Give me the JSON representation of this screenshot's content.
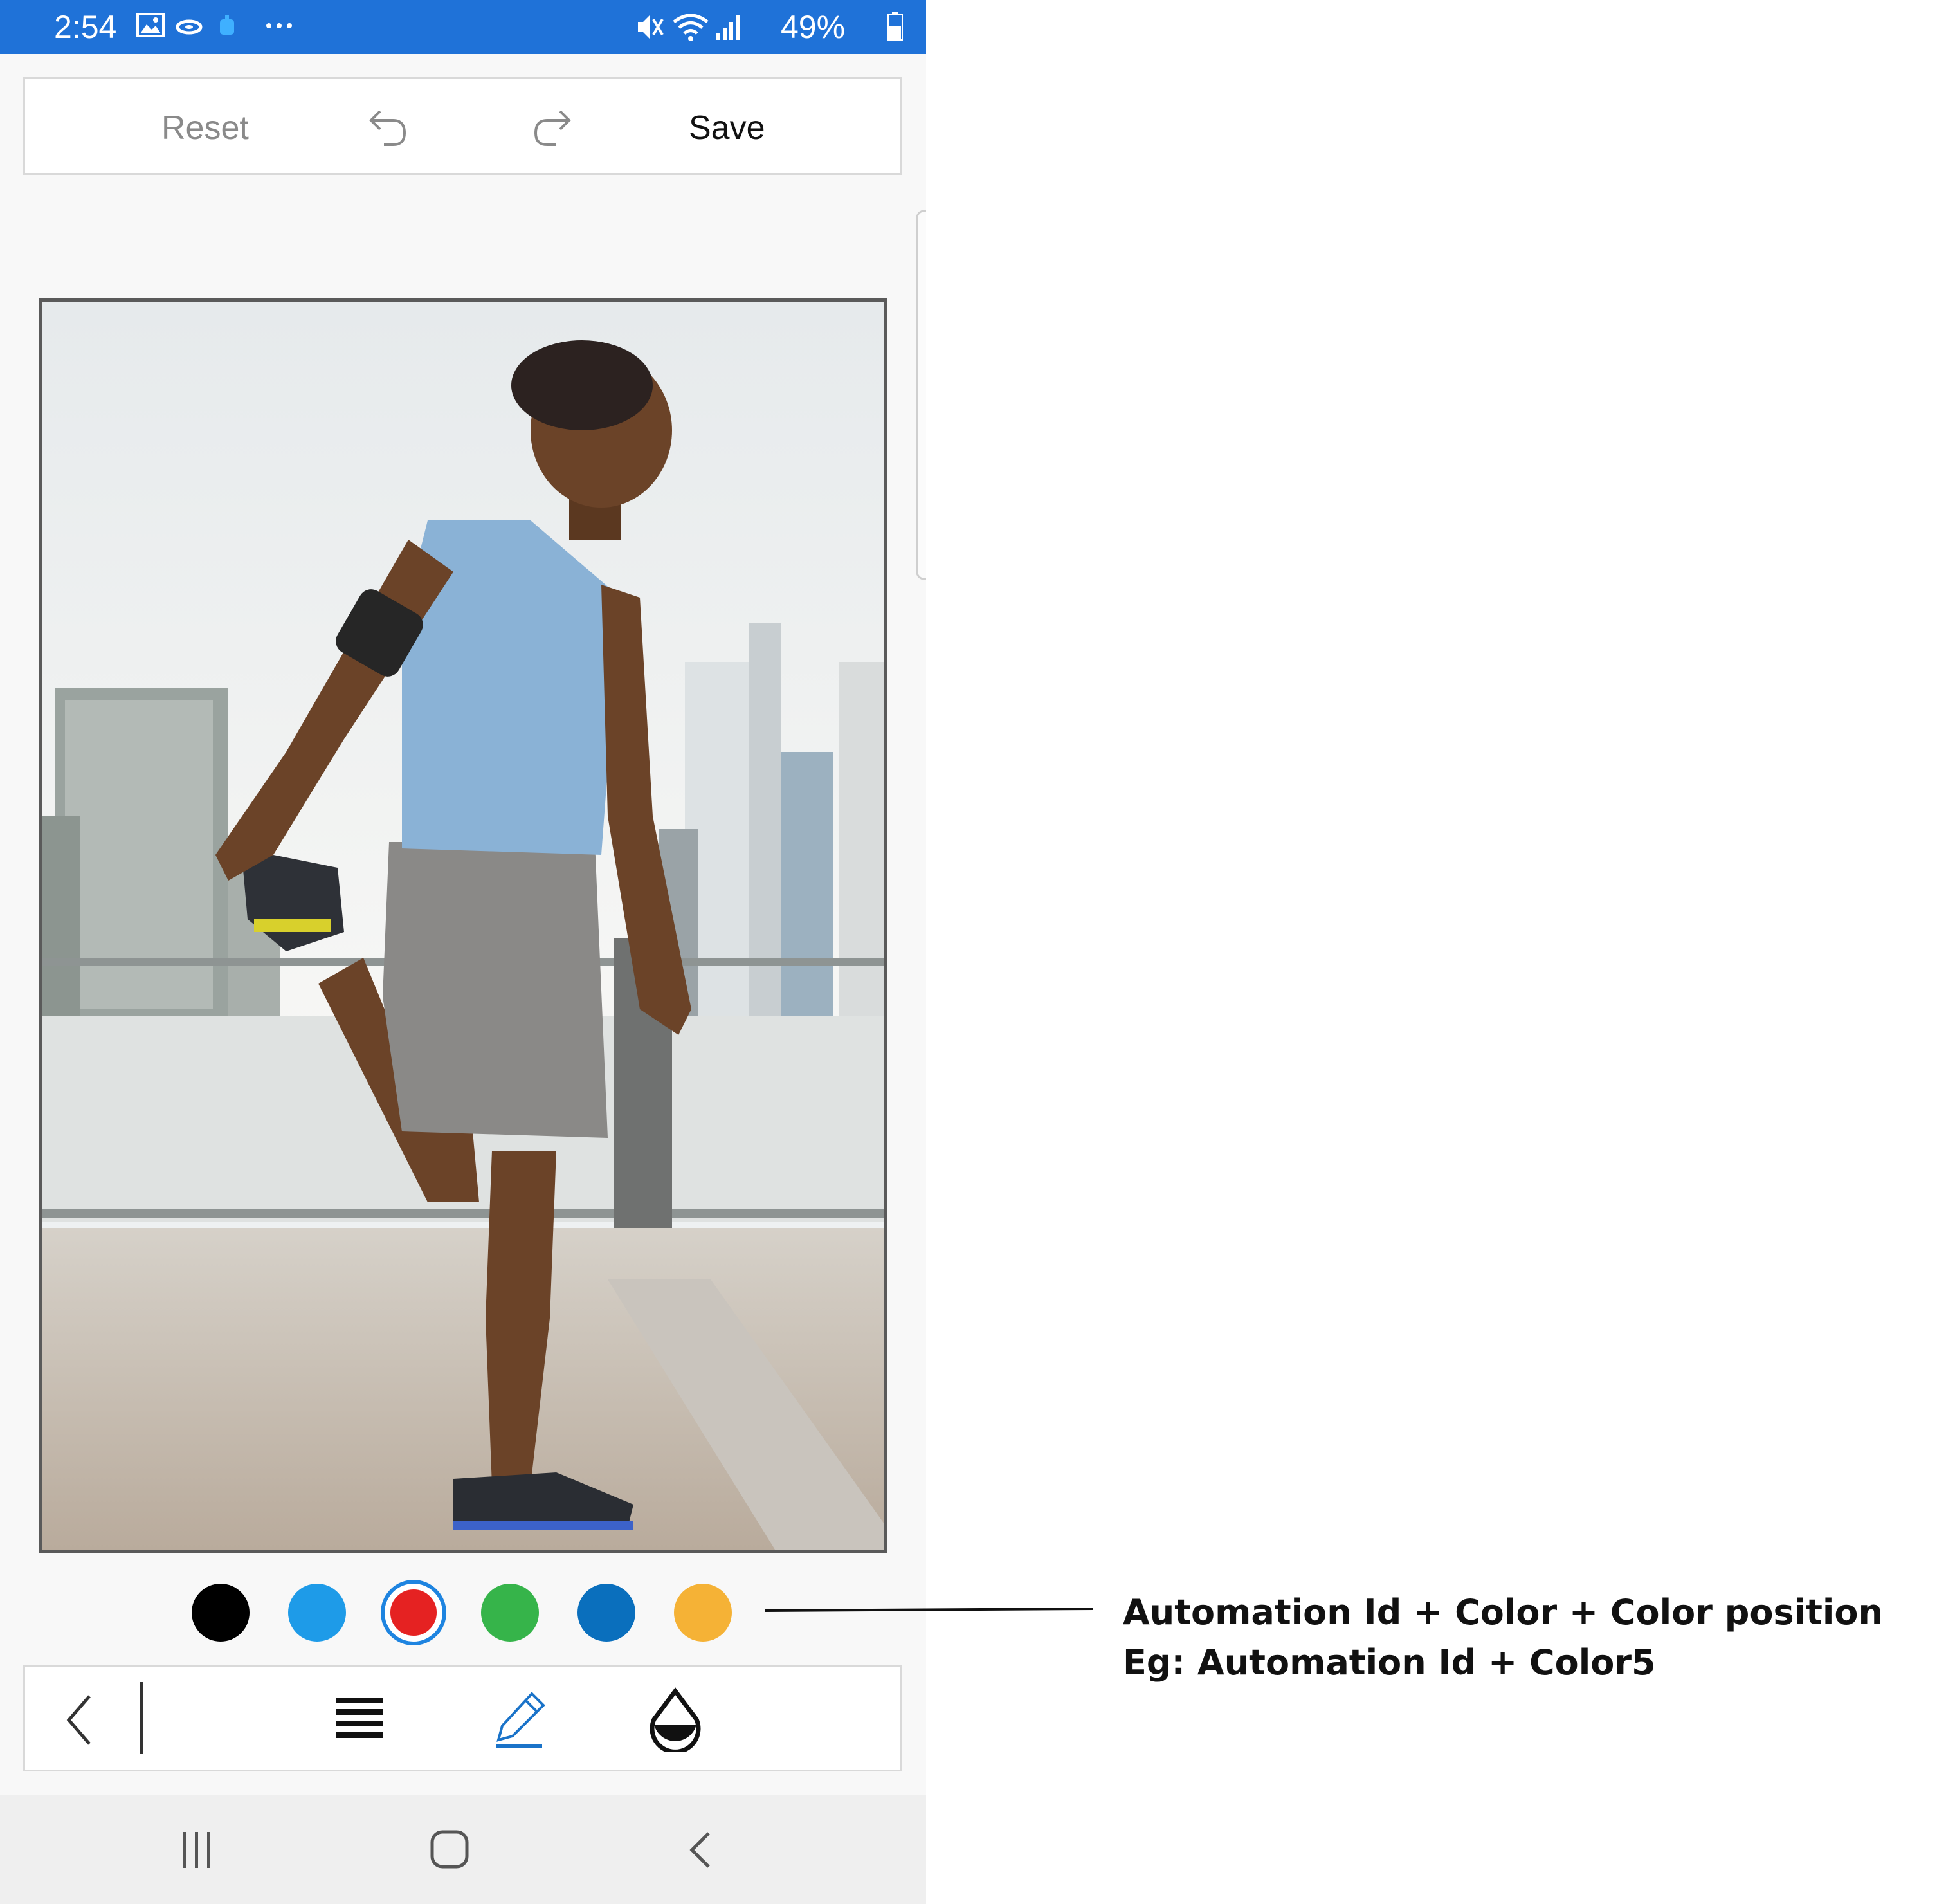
{
  "status_bar": {
    "time": "2:54",
    "battery": "49%",
    "icons": [
      "gallery-icon",
      "cloud-icon",
      "app-icon",
      "more-dots-icon",
      "mute-icon",
      "wifi-icon",
      "signal-icon",
      "battery-icon"
    ]
  },
  "toolbar": {
    "reset_label": "Reset",
    "undo_icon": "undo-icon",
    "redo_icon": "redo-icon",
    "save_label": "Save"
  },
  "canvas": {
    "image_description": "man stretching on a waterfront promenade with city skyline"
  },
  "color_palette": {
    "colors": [
      "#000000",
      "#1e9be8",
      "#e52222",
      "#36b44a",
      "#0a6fbd",
      "#f5b236"
    ],
    "selected": 3
  },
  "bottom_toolbar": {
    "icons": [
      "back-chevron-icon",
      "line-weight-icon",
      "pen-icon",
      "ink-drop-icon"
    ],
    "active_tool": "pen",
    "accent_color": "#1a73c9"
  },
  "nav_bar": {
    "icons": [
      "recent-apps-icon",
      "home-icon",
      "back-icon"
    ]
  },
  "annotation": {
    "line1": "Automation Id + Color + Color position",
    "line2": "Eg: Automation Id + Color5"
  },
  "colors": {
    "status_bar": "#1f72d8",
    "background": "#f8f8f8"
  }
}
